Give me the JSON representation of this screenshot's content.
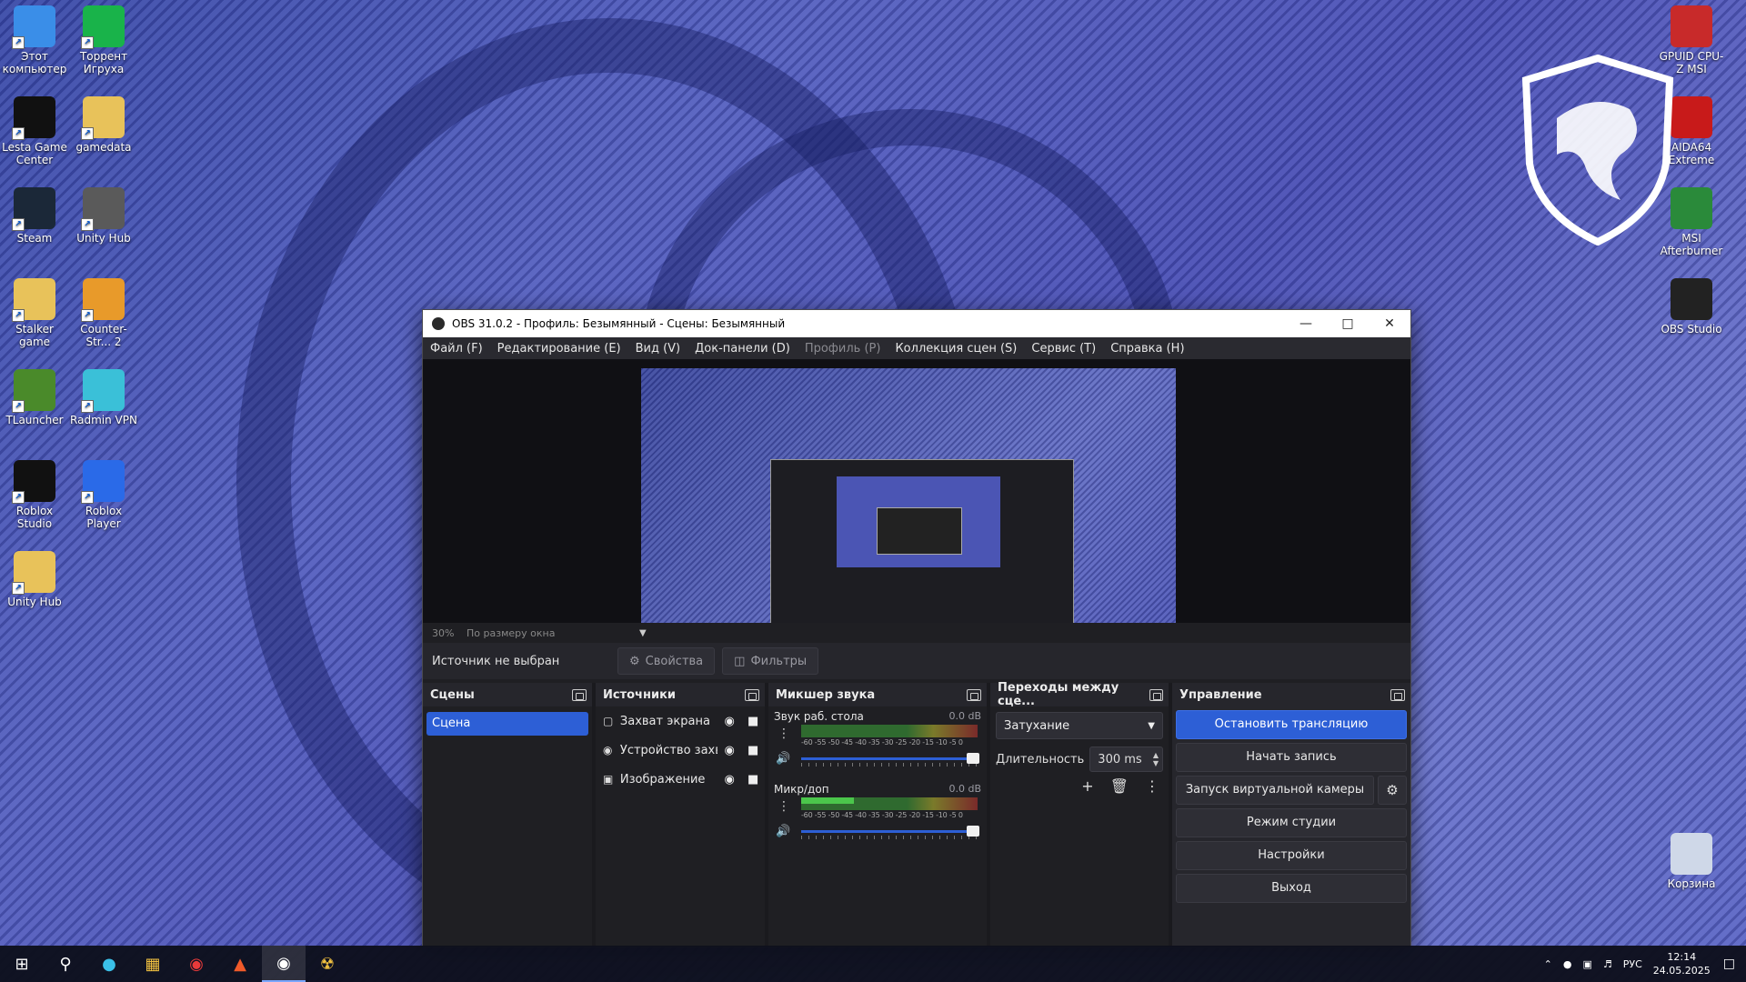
{
  "desktop": {
    "icons_left": [
      {
        "label": "Этот компьютер",
        "icon": "computer-icon",
        "color": "#3a8ee8"
      },
      {
        "label": "Торрент Игруха",
        "icon": "torrent-icon",
        "color": "#19b34a"
      },
      {
        "label": "Lesta Game Center",
        "icon": "lesta-icon",
        "color": "#111111"
      },
      {
        "label": "gamedata",
        "icon": "folder-icon",
        "color": "#e8c25a"
      },
      {
        "label": "Steam",
        "icon": "steam-icon",
        "color": "#1b2838"
      },
      {
        "label": "Unity Hub",
        "icon": "unity-icon",
        "color": "#5a5a5a"
      },
      {
        "label": "Stalker game",
        "icon": "folder-icon",
        "color": "#e8c25a"
      },
      {
        "label": "Counter-Str... 2",
        "icon": "cs2-icon",
        "color": "#e89a2a"
      },
      {
        "label": "TLauncher",
        "icon": "minecraft-icon",
        "color": "#4a8a2a"
      },
      {
        "label": "Radmin VPN",
        "icon": "radmin-icon",
        "color": "#3ac0d8"
      },
      {
        "label": "Roblox Studio",
        "icon": "roblox-studio-icon",
        "color": "#111111"
      },
      {
        "label": "Roblox Player",
        "icon": "roblox-icon",
        "color": "#2a6ae8"
      },
      {
        "label": "Unity Hub",
        "icon": "folder-icon",
        "color": "#e8c25a"
      }
    ],
    "icons_right": [
      {
        "label": "GPUID CPU-Z MSI",
        "icon": "cpuz-icon",
        "color": "#c82a2a"
      },
      {
        "label": "AIDA64 Extreme",
        "icon": "aida64-icon",
        "color": "#c81a1a"
      },
      {
        "label": "MSI Afterburner",
        "icon": "afterburner-icon",
        "color": "#2a8a3a"
      },
      {
        "label": "OBS Studio",
        "icon": "obs-icon",
        "color": "#222222"
      },
      {
        "label": "Корзина",
        "icon": "recycle-bin-icon",
        "color": "#cfd8e8"
      }
    ]
  },
  "obs": {
    "title": "OBS 31.0.2 - Профиль: Безымянный - Сцены: Безымянный",
    "menu": [
      {
        "label": "Файл (F)",
        "disabled": false
      },
      {
        "label": "Редактирование (E)",
        "disabled": false
      },
      {
        "label": "Вид (V)",
        "disabled": false
      },
      {
        "label": "Док-панели (D)",
        "disabled": false
      },
      {
        "label": "Профиль (P)",
        "disabled": true
      },
      {
        "label": "Коллекция сцен (S)",
        "disabled": false
      },
      {
        "label": "Сервис (T)",
        "disabled": false
      },
      {
        "label": "Справка (H)",
        "disabled": false
      }
    ],
    "zoom": "30%",
    "fit_label": "По размеру окна",
    "no_source": "Источник не выбран",
    "properties_label": "Свойства",
    "filters_label": "Фильтры",
    "docks": {
      "scenes_title": "Сцены",
      "sources_title": "Источники",
      "mixer_title": "Микшер звука",
      "transitions_title": "Переходы между сце...",
      "controls_title": "Управление"
    },
    "scenes": [
      "Сцена"
    ],
    "sources": [
      {
        "name": "Захват экрана",
        "icon": "monitor-icon"
      },
      {
        "name": "Устройство захв",
        "icon": "camera-icon"
      },
      {
        "name": "Изображение",
        "icon": "image-icon"
      }
    ],
    "mixer": [
      {
        "name": "Звук раб. стола",
        "db": "0.0 dB",
        "level": 0.0
      },
      {
        "name": "Микр/доп",
        "db": "0.0 dB",
        "level": 0.3
      }
    ],
    "meter_scale": "-60 -55 -50 -45 -40 -35 -30 -25 -20 -15 -10 -5 0",
    "transition": "Затухание",
    "duration_label": "Длительность",
    "duration_value": "300 ms",
    "controls": [
      {
        "label": "Остановить трансляцию",
        "active": true
      },
      {
        "label": "Начать запись",
        "active": false
      },
      {
        "label": "Запуск виртуальной камеры",
        "active": false
      },
      {
        "label": "Режим студии",
        "active": false
      },
      {
        "label": "Настройки",
        "active": false
      },
      {
        "label": "Выход",
        "active": false
      }
    ]
  },
  "taskbar": {
    "lang": "РУС",
    "time": "12:14",
    "date": "24.05.2025"
  }
}
